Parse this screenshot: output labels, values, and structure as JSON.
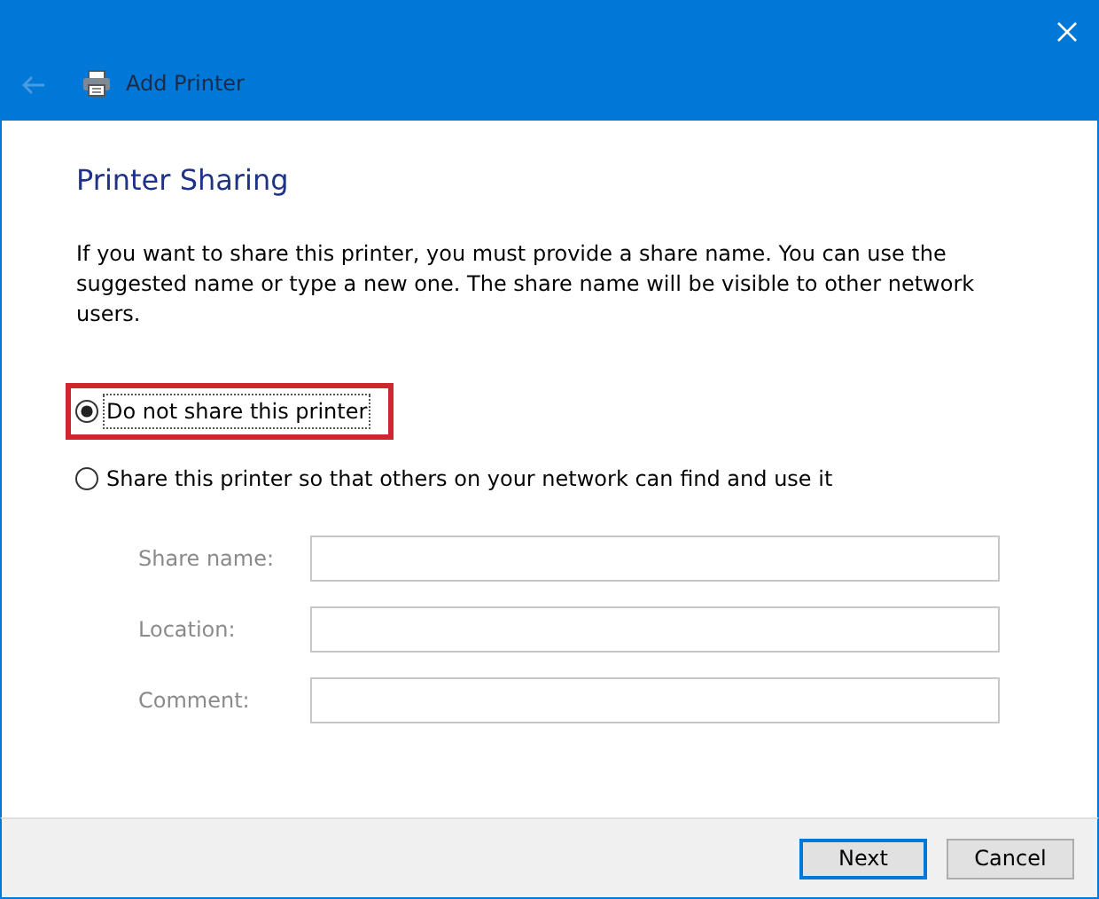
{
  "window": {
    "title": "Add Printer",
    "back_disabled": true
  },
  "heading": "Printer Sharing",
  "description": "If you want to share this printer, you must provide a share name. You can use the suggested name or type a new one. The share name will be visible to other network users.",
  "options": [
    {
      "label": "Do not share this printer",
      "selected": true,
      "highlighted": true
    },
    {
      "label": "Share this printer so that others on your network can find and use it",
      "selected": false,
      "highlighted": false
    }
  ],
  "fields": [
    {
      "label": "Share name:",
      "disabled": true
    },
    {
      "label": "Location:",
      "disabled": true
    },
    {
      "label": "Comment:",
      "disabled": true
    }
  ],
  "buttons": [
    {
      "label": "Next",
      "default": true
    },
    {
      "label": "Cancel",
      "default": false
    }
  ]
}
